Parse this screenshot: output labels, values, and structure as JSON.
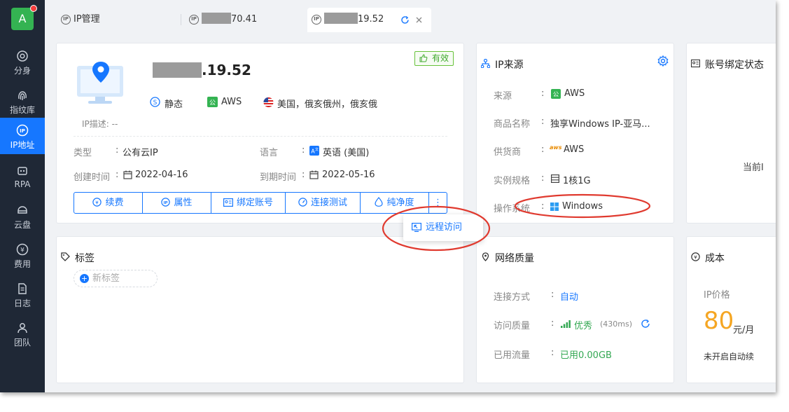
{
  "sidebar": {
    "avatar_letter": "A",
    "items": [
      {
        "label": "分身",
        "icon": "browser-profile-icon"
      },
      {
        "label": "指纹库",
        "icon": "fingerprint-icon"
      },
      {
        "label": "IP地址",
        "icon": "ip-icon"
      },
      {
        "label": "RPA",
        "icon": "robot-icon"
      },
      {
        "label": "云盘",
        "icon": "cloud-drive-icon"
      },
      {
        "label": "费用",
        "icon": "yen-icon"
      },
      {
        "label": "日志",
        "icon": "log-icon"
      },
      {
        "label": "团队",
        "icon": "team-icon"
      }
    ],
    "active_index": 2
  },
  "tabs": [
    {
      "label": "IP管理"
    },
    {
      "label_suffix": "70.41"
    },
    {
      "label_suffix": "19.52"
    }
  ],
  "ip_card": {
    "ip_suffix": ".19.52",
    "valid_label": "有效",
    "type_static": "静态",
    "provider": "AWS",
    "location": "美国，俄亥俄州，俄亥俄",
    "desc": "IP描述: --",
    "type_label": "类型",
    "type_value": "公有云IP",
    "lang_label": "语言",
    "lang_value": "英语 (美国)",
    "created_label": "创建时间",
    "created_value": "2022-04-16",
    "expire_label": "到期时间",
    "expire_value": "2022-05-16",
    "buttons": [
      "续费",
      "属性",
      "绑定账号",
      "连接测试",
      "纯净度"
    ],
    "more_label": "⋮",
    "popup_label": "远程访问"
  },
  "source_card": {
    "title": "IP来源",
    "rows": [
      {
        "label": "来源",
        "value": "AWS"
      },
      {
        "label": "商品名称",
        "value": "独享Windows IP-亚马..."
      },
      {
        "label": "供货商",
        "value": "AWS"
      },
      {
        "label": "实例规格",
        "value": "1核1G"
      },
      {
        "label": "操作系统",
        "value": "Windows"
      }
    ],
    "colon": ":",
    "aws_logo_text": "aws"
  },
  "bind_card": {
    "title": "账号绑定状态",
    "hint": "当前I"
  },
  "tag_card": {
    "title": "标签",
    "new_tag": "新标签"
  },
  "network_card": {
    "title": "网络质量",
    "rows": [
      {
        "label": "连接方式",
        "value": "自动"
      },
      {
        "label": "访问质量",
        "value": "优秀",
        "extra": "(430ms)"
      },
      {
        "label": "已用流量",
        "value": "已用0.00GB"
      }
    ]
  },
  "cost_card": {
    "title": "成本",
    "price_label": "IP价格",
    "price": "80",
    "unit": "元/月",
    "auto_renew": "未开启自动续"
  },
  "colors": {
    "primary": "#1677ff",
    "sidebar": "#1f2836",
    "green": "#34a853",
    "price": "#f5a623",
    "annotation": "#e03a2f"
  }
}
